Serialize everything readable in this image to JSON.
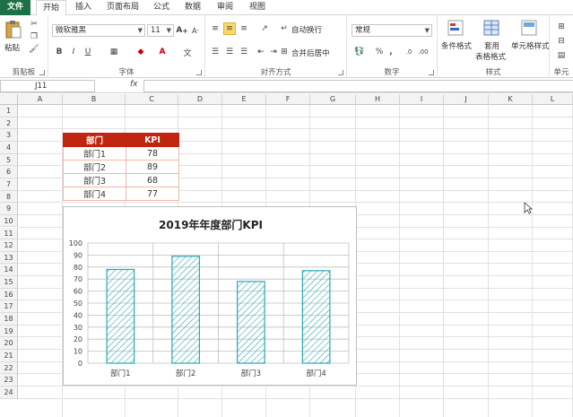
{
  "tabs": [
    "文件",
    "开始",
    "插入",
    "页面布局",
    "公式",
    "数据",
    "审阅",
    "视图"
  ],
  "ribbon": {
    "clipboard": {
      "paste": "粘贴",
      "label": "剪贴板"
    },
    "font": {
      "name": "微软雅黑",
      "size": "11",
      "bold": "B",
      "italic": "I",
      "underline": "U",
      "label": "字体"
    },
    "align": {
      "wrap": "自动换行",
      "merge": "合并后居中",
      "label": "对齐方式"
    },
    "number": {
      "format": "常规",
      "percent": "%",
      "comma": ",",
      "label": "数字"
    },
    "styles": {
      "cond": "条件格式",
      "table1": "套用",
      "table2": "表格格式",
      "cell": "单元格样式",
      "label": "样式"
    },
    "cells": {
      "label": "单元"
    }
  },
  "formula": {
    "namebox": "J11",
    "fx": "fx"
  },
  "columns": [
    "A",
    "B",
    "C",
    "D",
    "E",
    "F",
    "G",
    "H",
    "I",
    "J",
    "K",
    "L"
  ],
  "rows": [
    "1",
    "2",
    "3",
    "4",
    "5",
    "6",
    "7",
    "8",
    "9",
    "10",
    "11",
    "12",
    "13",
    "14",
    "15",
    "16",
    "17",
    "18",
    "19",
    "20",
    "21",
    "22",
    "23",
    "24"
  ],
  "table": {
    "headers": [
      "部门",
      "KPI"
    ],
    "rows": [
      [
        "部门1",
        "78"
      ],
      [
        "部门2",
        "89"
      ],
      [
        "部门3",
        "68"
      ],
      [
        "部门4",
        "77"
      ]
    ]
  },
  "chart_data": {
    "type": "bar",
    "title": "2019年年度部门KPI",
    "categories": [
      "部门1",
      "部门2",
      "部门3",
      "部门4"
    ],
    "values": [
      78,
      89,
      68,
      77
    ],
    "ylim": [
      0,
      100
    ],
    "yticks": [
      "0",
      "10",
      "20",
      "30",
      "40",
      "50",
      "60",
      "70",
      "80",
      "90",
      "100"
    ],
    "grid": true,
    "bar_color": "#2aa8b5",
    "pattern": "diagonal-hatch"
  },
  "colors": {
    "file_tab": "#1e7145",
    "table_header": "#c0260f",
    "table_border": "#f0b7a5"
  }
}
